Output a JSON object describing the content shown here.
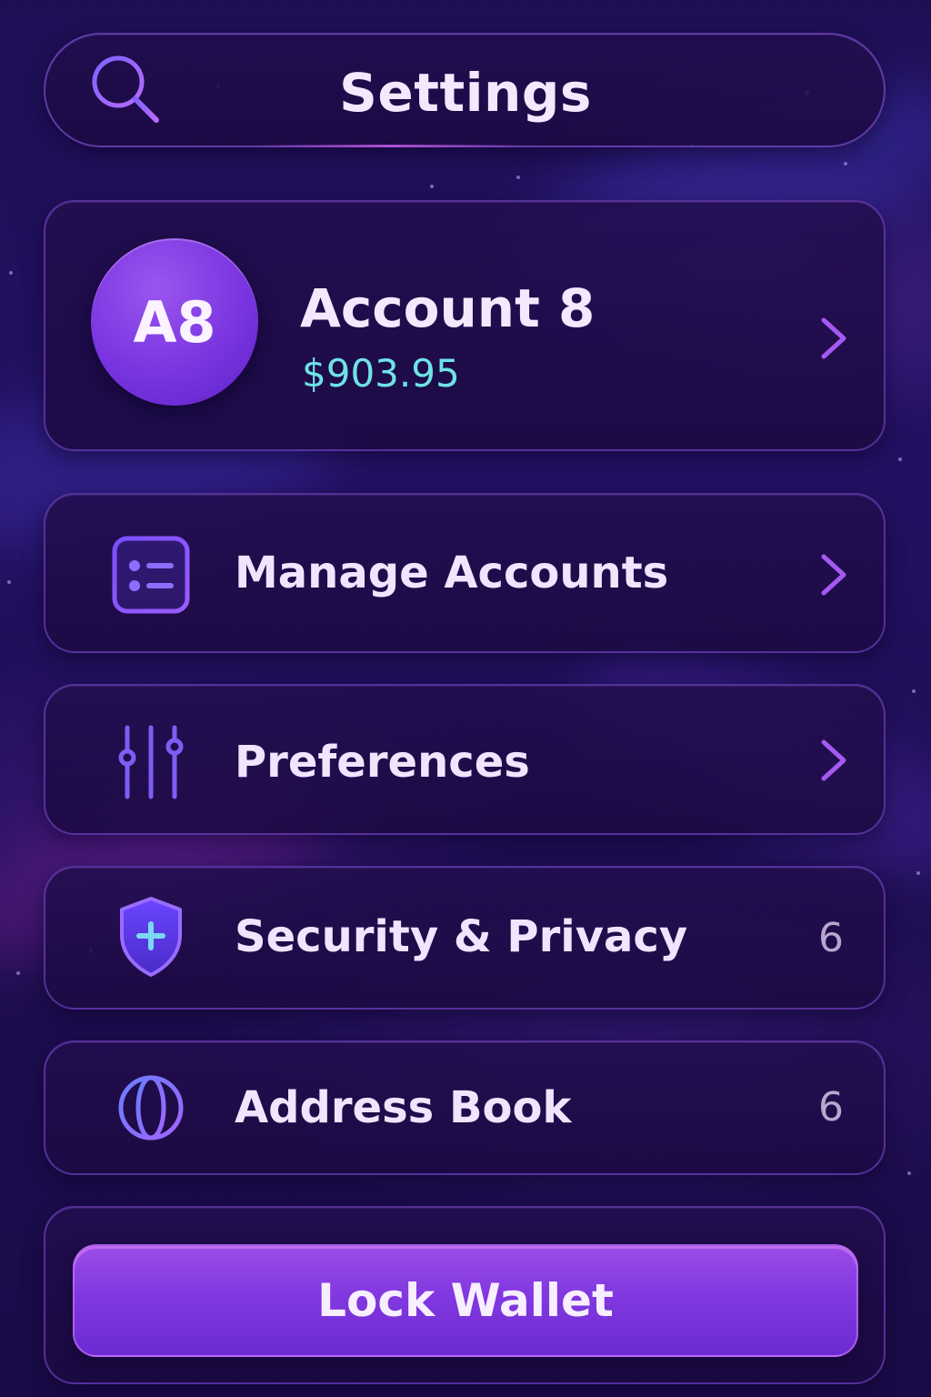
{
  "header": {
    "title": "Settings",
    "search_icon": "search-icon"
  },
  "account": {
    "avatar_initials": "A8",
    "name": "Account 8",
    "balance": "$903.95",
    "balance_color": "#6fe3e6"
  },
  "menu": {
    "items": [
      {
        "label": "Manage Accounts",
        "icon": "list-icon",
        "trailing": "chevron-right-icon"
      },
      {
        "label": "Preferences",
        "icon": "sliders-icon",
        "trailing": "chevron-right-icon"
      },
      {
        "label": "Security & Privacy",
        "icon": "shield-icon",
        "count": "6"
      },
      {
        "label": "Address Book",
        "icon": "globe-icon",
        "count": "6"
      }
    ]
  },
  "lock": {
    "label": "Lock Wallet"
  },
  "colors": {
    "accent": "#8a3fe4",
    "background": "#1f0f58",
    "card_border": "#8250dc"
  }
}
